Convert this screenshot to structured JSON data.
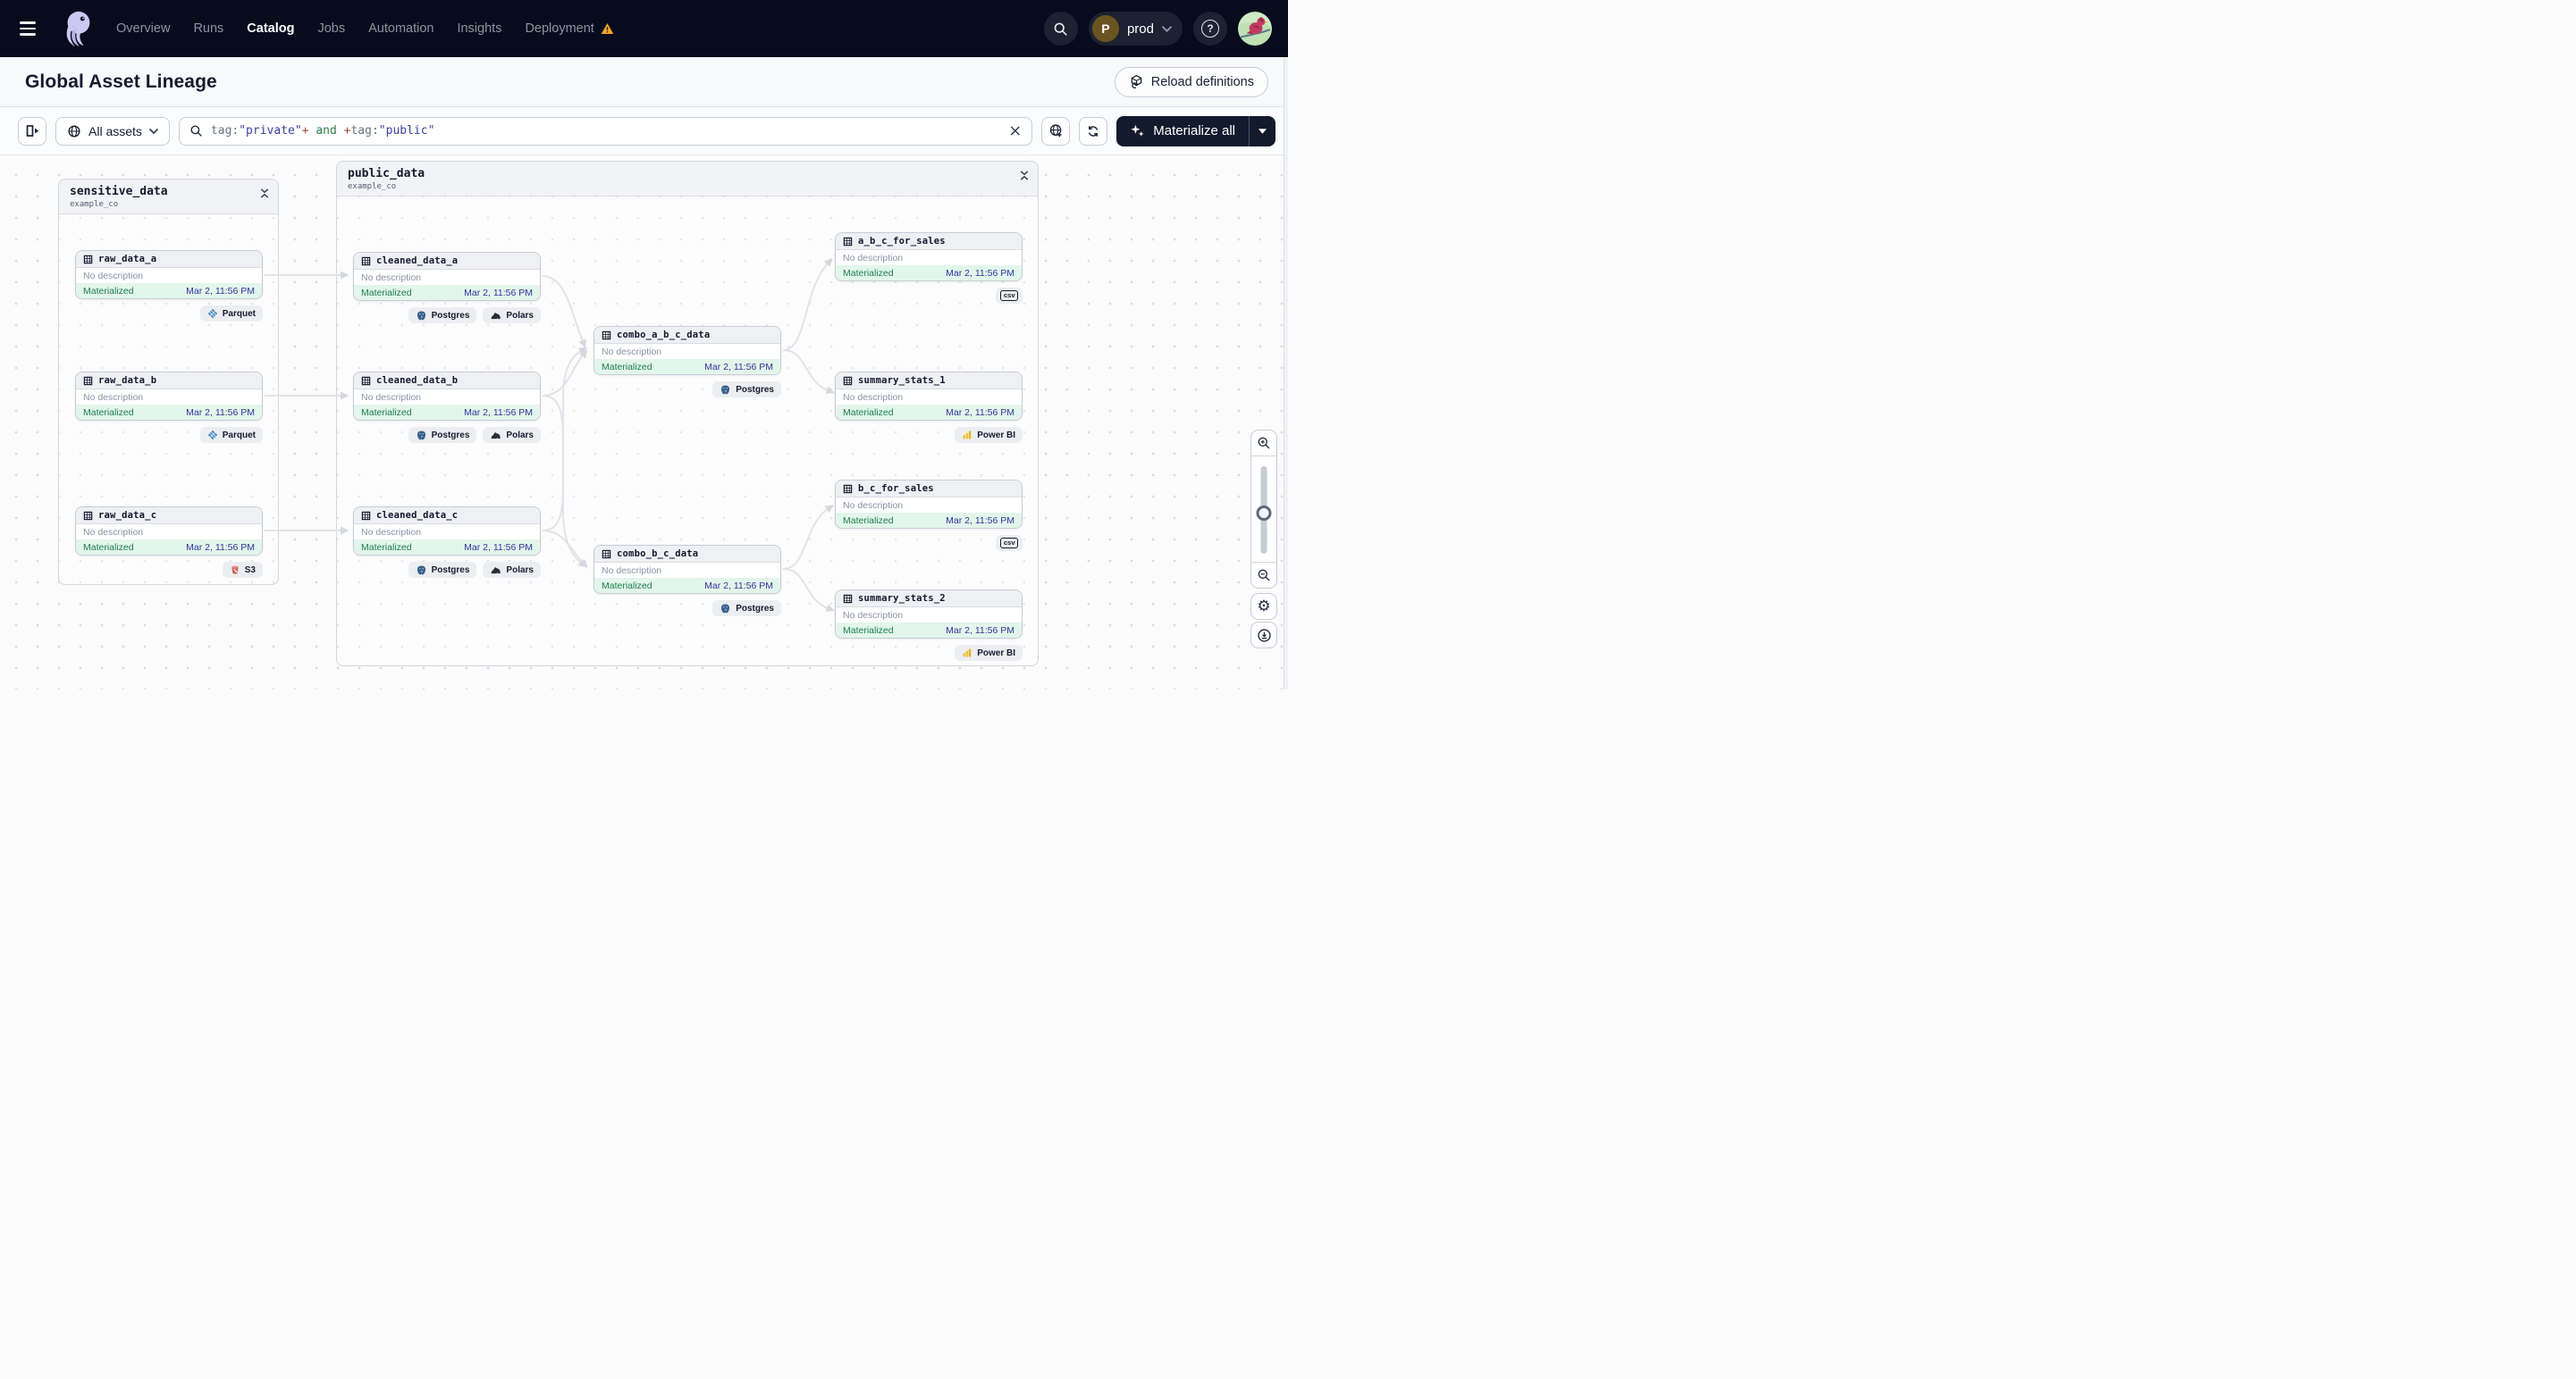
{
  "nav": {
    "items": [
      {
        "label": "Overview"
      },
      {
        "label": "Runs"
      },
      {
        "label": "Catalog"
      },
      {
        "label": "Jobs"
      },
      {
        "label": "Automation"
      },
      {
        "label": "Insights"
      },
      {
        "label": "Deployment"
      }
    ],
    "environment": {
      "initial": "P",
      "label": "prod"
    },
    "help_glyph": "?"
  },
  "header": {
    "title": "Global Asset Lineage",
    "reload_button": "Reload definitions"
  },
  "toolbar": {
    "scope_label": "All assets",
    "query_segments": [
      {
        "text": "tag:",
        "kind": "field"
      },
      {
        "text": "\"private\"",
        "kind": "string"
      },
      {
        "text": "+",
        "kind": "operator"
      },
      {
        "text": " and ",
        "kind": "keyword"
      },
      {
        "text": "+",
        "kind": "operator"
      },
      {
        "text": "tag:",
        "kind": "field"
      },
      {
        "text": "\"public\"",
        "kind": "string"
      }
    ],
    "clear_icon": "×",
    "materialize_label": "Materialize all"
  },
  "canvas_controls": {
    "gear_glyph": "⚙",
    "icons": [
      "zoom-in",
      "zoom-slider",
      "zoom-out",
      "settings",
      "download"
    ]
  },
  "colors": {
    "accent_dark": "#131a2d",
    "status_green": "#1d7d4f",
    "timestamp_indigo": "#30349b",
    "warning_orange": "#f6a724"
  },
  "canvas": {
    "groups": [
      {
        "name": "sensitive_data",
        "subtitle": "example_co",
        "nodes": [
          {
            "name": "raw_data_a",
            "description": "No description",
            "status": "Materialized",
            "timestamp": "Mar 2, 11:56 PM",
            "tags": [
              {
                "label": "Parquet",
                "icon": "parquet-icon"
              }
            ]
          },
          {
            "name": "raw_data_b",
            "description": "No description",
            "status": "Materialized",
            "timestamp": "Mar 2, 11:56 PM",
            "tags": [
              {
                "label": "Parquet",
                "icon": "parquet-icon"
              }
            ]
          },
          {
            "name": "raw_data_c",
            "description": "No description",
            "status": "Materialized",
            "timestamp": "Mar 2, 11:56 PM",
            "tags": [
              {
                "label": "S3",
                "icon": "s3-bucket-icon"
              }
            ]
          }
        ]
      },
      {
        "name": "public_data",
        "subtitle": "example_co",
        "nodes": [
          {
            "name": "cleaned_data_a",
            "description": "No description",
            "status": "Materialized",
            "timestamp": "Mar 2, 11:56 PM",
            "tags": [
              {
                "label": "Postgres",
                "icon": "postgres-icon"
              },
              {
                "label": "Polars",
                "icon": "polars-icon"
              }
            ]
          },
          {
            "name": "cleaned_data_b",
            "description": "No description",
            "status": "Materialized",
            "timestamp": "Mar 2, 11:56 PM",
            "tags": [
              {
                "label": "Postgres",
                "icon": "postgres-icon"
              },
              {
                "label": "Polars",
                "icon": "polars-icon"
              }
            ]
          },
          {
            "name": "cleaned_data_c",
            "description": "No description",
            "status": "Materialized",
            "timestamp": "Mar 2, 11:56 PM",
            "tags": [
              {
                "label": "Postgres",
                "icon": "postgres-icon"
              },
              {
                "label": "Polars",
                "icon": "polars-icon"
              }
            ]
          },
          {
            "name": "combo_a_b_c_data",
            "description": "No description",
            "status": "Materialized",
            "timestamp": "Mar 2, 11:56 PM",
            "tags": [
              {
                "label": "Postgres",
                "icon": "postgres-icon"
              }
            ]
          },
          {
            "name": "combo_b_c_data",
            "description": "No description",
            "status": "Materialized",
            "timestamp": "Mar 2, 11:56 PM",
            "tags": [
              {
                "label": "Postgres",
                "icon": "postgres-icon"
              }
            ]
          },
          {
            "name": "a_b_c_for_sales",
            "description": "No description",
            "status": "Materialized",
            "timestamp": "Mar 2, 11:56 PM",
            "tags": [
              {
                "label": "csv",
                "icon": "csv-icon"
              }
            ]
          },
          {
            "name": "summary_stats_1",
            "description": "No description",
            "status": "Materialized",
            "timestamp": "Mar 2, 11:56 PM",
            "tags": [
              {
                "label": "Power BI",
                "icon": "powerbi-icon"
              }
            ]
          },
          {
            "name": "b_c_for_sales",
            "description": "No description",
            "status": "Materialized",
            "timestamp": "Mar 2, 11:56 PM",
            "tags": [
              {
                "label": "csv",
                "icon": "csv-icon"
              }
            ]
          },
          {
            "name": "summary_stats_2",
            "description": "No description",
            "status": "Materialized",
            "timestamp": "Mar 2, 11:56 PM",
            "tags": [
              {
                "label": "Power BI",
                "icon": "powerbi-icon"
              }
            ]
          }
        ]
      }
    ]
  }
}
